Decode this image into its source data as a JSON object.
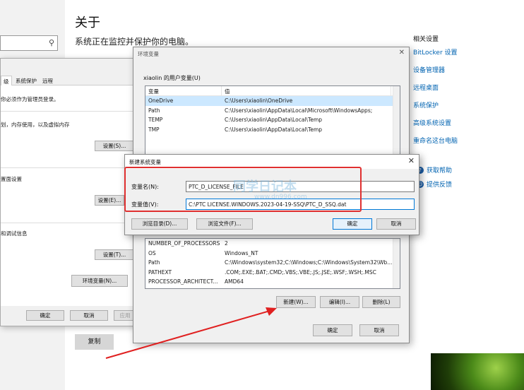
{
  "settings": {
    "title": "关于",
    "subtitle": "系统正在监控并保护你的电脑。",
    "related_title": "相关设置",
    "related_links": [
      "BitLocker 设置",
      "设备管理器",
      "远程桌面",
      "系统保护",
      "高级系统设置",
      "重命名这台电脑"
    ],
    "help_links": [
      "获取帮助",
      "提供反馈"
    ],
    "copy_button": "复制"
  },
  "system_properties": {
    "tabs": [
      "级",
      "系统保护",
      "远程"
    ],
    "lines": [
      "你必须作为管理员登录。",
      "划，内存使用，以及虚拟内存",
      "置面设置",
      "和调试信息"
    ],
    "settings_button": "设置(S)...",
    "settings_button2": "设置(E)...",
    "settings_button3": "设置(T)...",
    "env_button": "环境变量(N)...",
    "ok": "确定",
    "cancel": "取消",
    "apply": "应用"
  },
  "env_vars": {
    "title": "环境变量",
    "user_group_label": "xiaolin 的用户变量(U)",
    "col_var": "变量",
    "col_value": "值",
    "user_rows": [
      {
        "name": "OneDrive",
        "value": "C:\\Users\\xiaolin\\OneDrive"
      },
      {
        "name": "Path",
        "value": "C:\\Users\\xiaolin\\AppData\\Local\\Microsoft\\WindowsApps;"
      },
      {
        "name": "TEMP",
        "value": "C:\\Users\\xiaolin\\AppData\\Local\\Temp"
      },
      {
        "name": "TMP",
        "value": "C:\\Users\\xiaolin\\AppData\\Local\\Temp"
      }
    ],
    "system_rows": [
      {
        "name": "NUMBER_OF_PROCESSORS",
        "value": "2"
      },
      {
        "name": "OS",
        "value": "Windows_NT"
      },
      {
        "name": "Path",
        "value": "C:\\Windows\\system32;C:\\Windows;C:\\Windows\\System32\\Wb..."
      },
      {
        "name": "PATHEXT",
        "value": ".COM;.EXE;.BAT;.CMD;.VBS;.VBE;.JS;.JSE;.WSF;.WSH;.MSC"
      },
      {
        "name": "PROCESSOR_ARCHITECT...",
        "value": "AMD64"
      }
    ],
    "new_button": "新建(W)...",
    "edit_button": "编辑(I)...",
    "delete_button": "删除(L)",
    "ok": "确定",
    "cancel": "取消"
  },
  "new_var": {
    "title": "新建系统变量",
    "name_label": "变量名(N):",
    "name_value": "PTC_D_LICENSE_FILE",
    "value_label": "变量值(V):",
    "value_value": "C:\\PTC LICENSE.WINDOWS.2023-04-19-SSQ\\PTC_D_SSQ.dat",
    "browse_dir": "浏览目录(D)...",
    "browse_file": "浏览文件(F)...",
    "ok": "确定",
    "cancel": "取消"
  },
  "watermark": {
    "text": "同学日记本",
    "url": "www.dn996.com"
  }
}
